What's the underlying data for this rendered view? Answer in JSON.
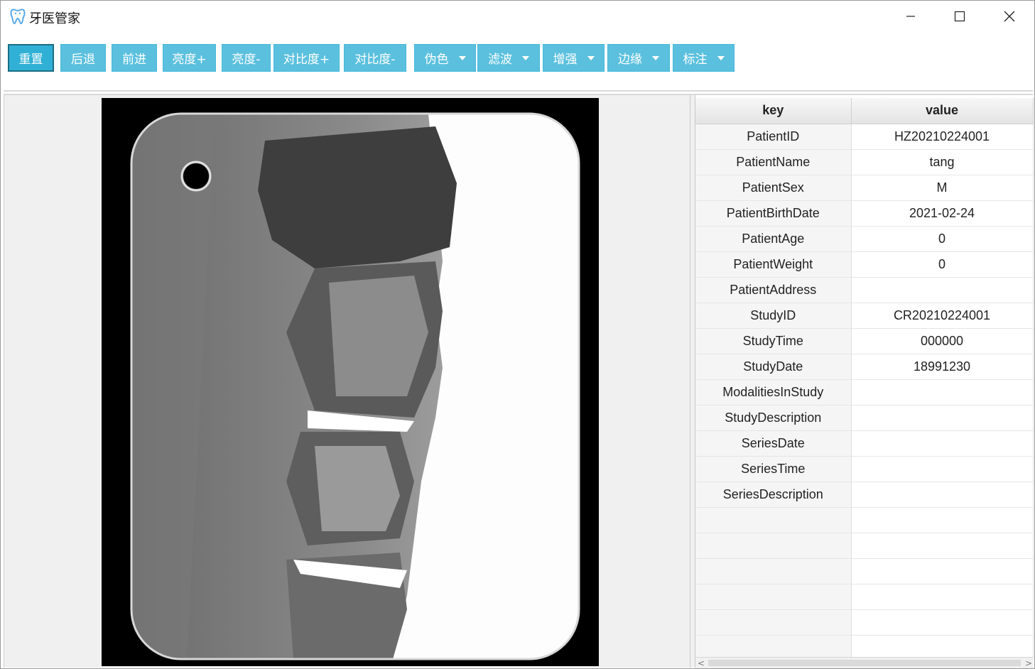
{
  "window": {
    "title": "牙医管家",
    "icon": "tooth-icon",
    "controls": [
      "minimize-icon",
      "maximize-icon",
      "close-icon"
    ]
  },
  "toolbar": {
    "buttons": [
      {
        "label": "重置",
        "active": true
      },
      {
        "label": "后退"
      },
      {
        "label": "前进"
      },
      {
        "label": "亮度+"
      },
      {
        "label": "亮度-"
      },
      {
        "label": "对比度+"
      },
      {
        "label": "对比度-"
      }
    ],
    "dropdowns": [
      {
        "label": "伪色"
      },
      {
        "label": "滤波"
      },
      {
        "label": "增强"
      },
      {
        "label": "边缘"
      },
      {
        "label": "标注"
      }
    ],
    "accent_color": "#5bc0de"
  },
  "viewer": {
    "image": "dental-xray-image"
  },
  "info_table": {
    "columns": [
      "key",
      "value"
    ],
    "rows": [
      {
        "key": "PatientID",
        "value": "HZ20210224001"
      },
      {
        "key": "PatientName",
        "value": "tang"
      },
      {
        "key": "PatientSex",
        "value": "M"
      },
      {
        "key": "PatientBirthDate",
        "value": "2021-02-24"
      },
      {
        "key": "PatientAge",
        "value": "0"
      },
      {
        "key": "PatientWeight",
        "value": "0"
      },
      {
        "key": "PatientAddress",
        "value": ""
      },
      {
        "key": "StudyID",
        "value": "CR20210224001"
      },
      {
        "key": "StudyTime",
        "value": "000000"
      },
      {
        "key": "StudyDate",
        "value": "18991230"
      },
      {
        "key": "ModalitiesInStudy",
        "value": ""
      },
      {
        "key": "StudyDescription",
        "value": ""
      },
      {
        "key": "SeriesDate",
        "value": ""
      },
      {
        "key": "SeriesTime",
        "value": ""
      },
      {
        "key": "SeriesDescription",
        "value": ""
      },
      {
        "key": "",
        "value": ""
      },
      {
        "key": "",
        "value": ""
      },
      {
        "key": "",
        "value": ""
      },
      {
        "key": "",
        "value": ""
      },
      {
        "key": "",
        "value": ""
      },
      {
        "key": "",
        "value": ""
      }
    ]
  }
}
